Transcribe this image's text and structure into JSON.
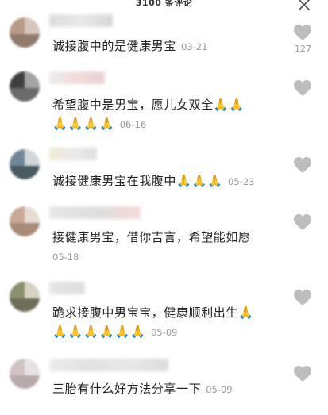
{
  "header": {
    "title": "3100 条评论"
  },
  "comments": [
    {
      "text": "诚接腹中的是健康男宝",
      "date": "03-21",
      "like_count": "127"
    },
    {
      "text_line1": "希望腹中是男宝，愿儿女双全",
      "emoji_line1": "🙏🙏",
      "emoji_line2": "🙏🙏🙏🙏",
      "date": "06-16"
    },
    {
      "text": "诚接健康男宝在我腹中",
      "emoji": "🙏🙏🙏",
      "date": "05-23"
    },
    {
      "text": "接健康男宝，借你吉言，希望能如愿",
      "date": "05-18"
    },
    {
      "text_line1": "跪求接腹中男宝宝，健康顺利出生",
      "emoji_line1": "🙏",
      "emoji_line2": "🙏🙏🙏🙏🙏🙏",
      "date": "05-09"
    },
    {
      "text": "三胎有什么好方法分享一下",
      "date": "05-09"
    }
  ],
  "icons": {
    "like": "heart-icon",
    "close": "close-icon"
  },
  "colors": {
    "like_icon": "#bdbdbd",
    "date_text": "#9a9a9a"
  }
}
